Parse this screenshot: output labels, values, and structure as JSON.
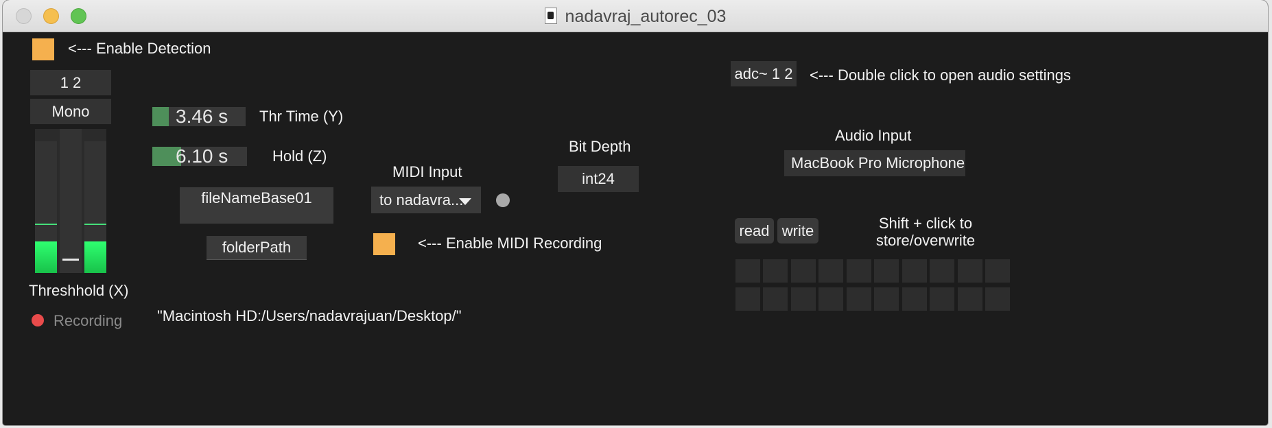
{
  "window": {
    "title": "nadavraj_autorec_03"
  },
  "detection": {
    "label": "<--- Enable Detection"
  },
  "channels": {
    "value": "1 2"
  },
  "mode": {
    "value": "Mono"
  },
  "meter": {
    "left_level": 0.22,
    "right_level": 0.22,
    "threshold": 0.08
  },
  "threshold_label": "Threshhold (X)",
  "recording": {
    "label": "Recording"
  },
  "thr_time": {
    "value": "3.46 s",
    "label": "Thr Time (Y)",
    "fill_fraction": 0.17
  },
  "hold": {
    "value": "6.10 s",
    "label": "Hold (Z)",
    "fill_fraction": 0.3
  },
  "file_name_base": {
    "value": "fileNameBase01"
  },
  "folder_path": {
    "label": "folderPath"
  },
  "path_text": "\"Macintosh HD:/Users/nadavrajuan/Desktop/\"",
  "midi": {
    "input_label": "MIDI Input",
    "selected": "to nadavra...",
    "enable_label": "<--- Enable MIDI Recording"
  },
  "bit_depth": {
    "label": "Bit Depth",
    "value": "int24"
  },
  "adc": {
    "label": "adc~ 1 2",
    "hint": "<--- Double click to open audio settings"
  },
  "audio_input": {
    "label": "Audio Input",
    "value": "MacBook Pro Microphone"
  },
  "presets": {
    "read_label": "read",
    "write_label": "write",
    "hint": "Shift + click to store/overwrite"
  },
  "colors": {
    "toggle": "#f5b04e",
    "meter_green": "#2fff70",
    "record_dot": "#e94b4b",
    "background": "#1c1c1c"
  }
}
